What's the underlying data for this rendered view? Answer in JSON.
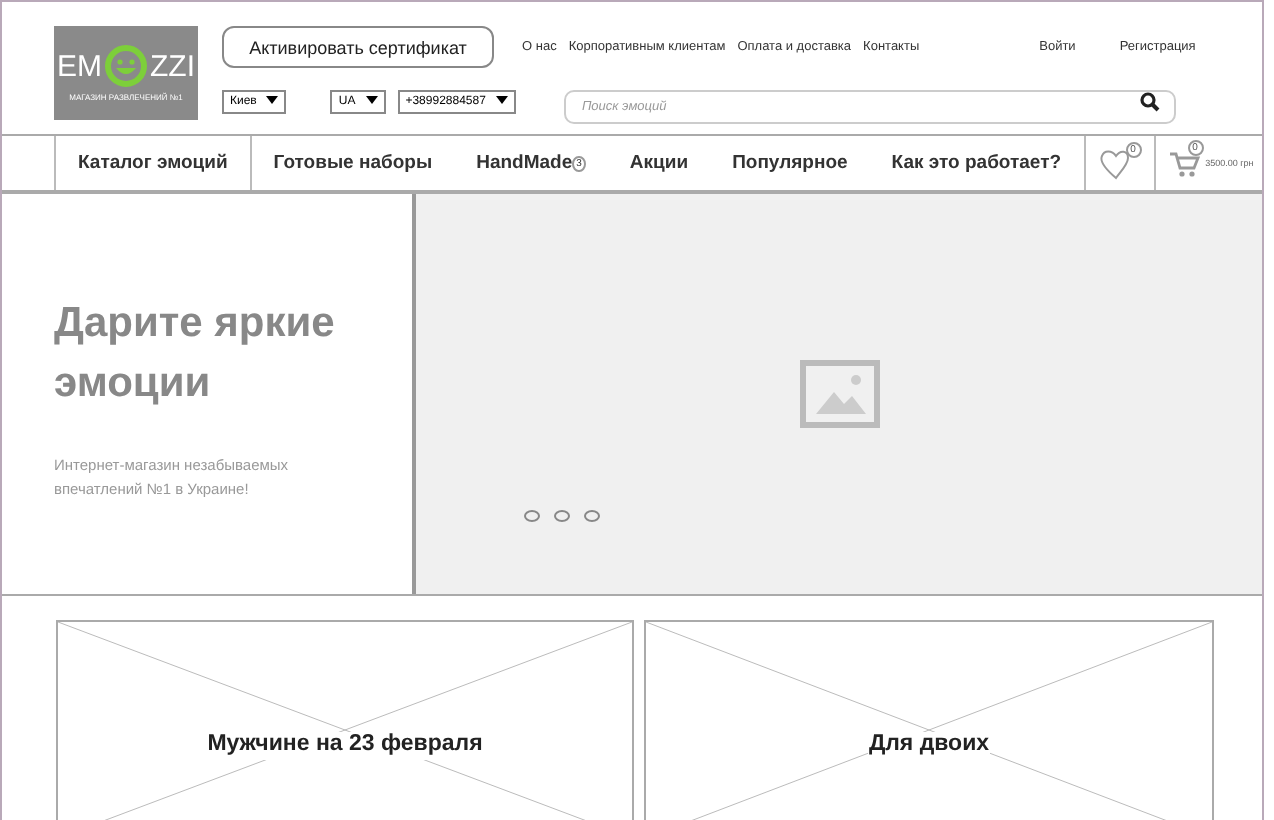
{
  "logo": {
    "left": "EM",
    "right": "ZZI",
    "tagline": "МАГАЗИН РАЗВЛЕЧЕНИЙ №1"
  },
  "certificate_button": "Активировать сертификат",
  "top_links": [
    "О нас",
    "Корпоративным клиентам",
    "Оплата и доставка",
    "Контакты"
  ],
  "account_links": [
    "Войти",
    "Регистрация"
  ],
  "selects": [
    {
      "value": "Киев"
    },
    {
      "value": "UA"
    },
    {
      "value": "+38992884587"
    }
  ],
  "search": {
    "placeholder": "Поиск эмоций"
  },
  "nav": [
    {
      "label": "Каталог эмоций",
      "selected": true
    },
    {
      "label": "Готовые наборы",
      "selected": false
    },
    {
      "label": "HandMade",
      "selected": false,
      "badge": "3"
    },
    {
      "label": "Акции",
      "selected": false
    },
    {
      "label": "Популярное",
      "selected": false
    },
    {
      "label": "Как это работает?",
      "selected": false
    }
  ],
  "wishlist": {
    "count": "0"
  },
  "cart": {
    "count": "0",
    "total": "3500.00 грн"
  },
  "hero": {
    "title": "Дарите яркие эмоции",
    "subtitle": "Интернет-магазин незабываемых впечатлений №1 в Украине!",
    "slides": [
      {
        "selected": false
      },
      {
        "selected": false
      },
      {
        "selected": false
      }
    ]
  },
  "categories": [
    {
      "title": "Мужчине на 23 февраля"
    },
    {
      "title": "Для двоих"
    }
  ]
}
